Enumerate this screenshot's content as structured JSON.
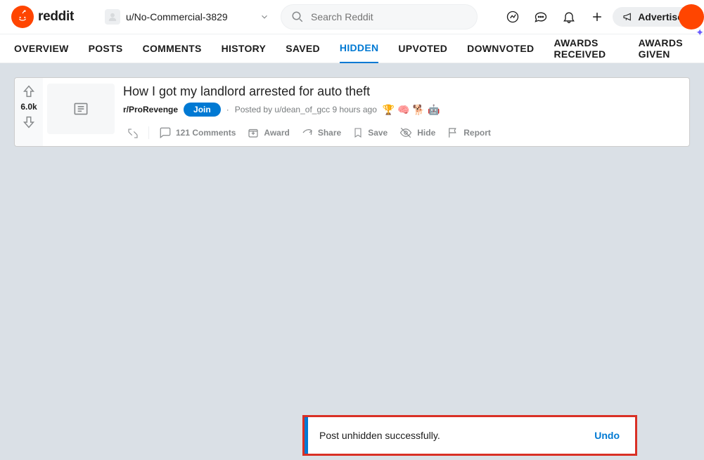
{
  "header": {
    "brand": "reddit",
    "username": "u/No-Commercial-3829",
    "search_placeholder": "Search Reddit",
    "advertise_label": "Advertise"
  },
  "tabs": [
    {
      "label": "OVERVIEW",
      "active": false
    },
    {
      "label": "POSTS",
      "active": false
    },
    {
      "label": "COMMENTS",
      "active": false
    },
    {
      "label": "HISTORY",
      "active": false
    },
    {
      "label": "SAVED",
      "active": false
    },
    {
      "label": "HIDDEN",
      "active": true
    },
    {
      "label": "UPVOTED",
      "active": false
    },
    {
      "label": "DOWNVOTED",
      "active": false
    },
    {
      "label": "AWARDS RECEIVED",
      "active": false
    },
    {
      "label": "AWARDS GIVEN",
      "active": false
    }
  ],
  "post": {
    "score": "6.0k",
    "title": "How I got my landlord arrested for auto theft",
    "subreddit": "r/ProRevenge",
    "join_label": "Join",
    "posted_by_prefix": "Posted by ",
    "author": "u/dean_of_gcc",
    "time": "9 hours ago",
    "awards": [
      "🏆",
      "🧠",
      "🐕",
      "🤖"
    ],
    "actions": {
      "comments": "121 Comments",
      "award": "Award",
      "share": "Share",
      "save": "Save",
      "hide": "Hide",
      "report": "Report"
    }
  },
  "toast": {
    "message": "Post unhidden successfully.",
    "undo": "Undo"
  }
}
